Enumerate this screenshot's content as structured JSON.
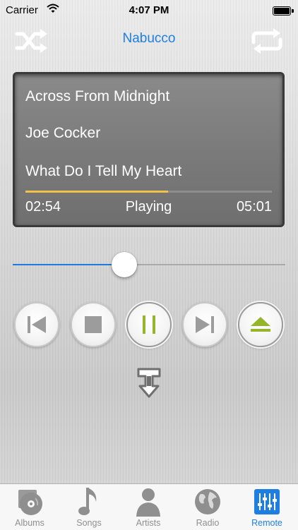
{
  "status_bar": {
    "carrier": "Carrier",
    "time": "4:07 PM"
  },
  "header": {
    "title": "Nabucco",
    "shuffle_icon": "shuffle-icon",
    "repeat_icon": "repeat-icon"
  },
  "now_playing": {
    "album": "Across From Midnight",
    "artist": "Joe Cocker",
    "track": "What Do I Tell My Heart",
    "elapsed": "02:54",
    "state": "Playing",
    "total": "05:01",
    "progress_fraction": 0.58
  },
  "volume": {
    "level_fraction": 0.41
  },
  "transport": [
    {
      "id": "previous",
      "icon": "skip-previous-icon",
      "active": false
    },
    {
      "id": "stop",
      "icon": "stop-icon",
      "active": false
    },
    {
      "id": "pause",
      "icon": "pause-icon",
      "active": true
    },
    {
      "id": "next",
      "icon": "skip-next-icon",
      "active": false
    },
    {
      "id": "eject",
      "icon": "eject-icon",
      "active": true
    }
  ],
  "output_icon": "audio-output-icon",
  "tabs": [
    {
      "label": "Albums",
      "icon": "albums-icon",
      "active": false
    },
    {
      "label": "Songs",
      "icon": "music-note-icon",
      "active": false
    },
    {
      "label": "Artists",
      "icon": "artist-icon",
      "active": false
    },
    {
      "label": "Radio",
      "icon": "globe-icon",
      "active": false
    },
    {
      "label": "Remote",
      "icon": "equalizer-icon",
      "active": true
    }
  ],
  "colors": {
    "accent": "#1e7fe0",
    "progress": "#f0c24a",
    "control_green": "#97b52a",
    "control_grey": "#9c9c9c"
  }
}
